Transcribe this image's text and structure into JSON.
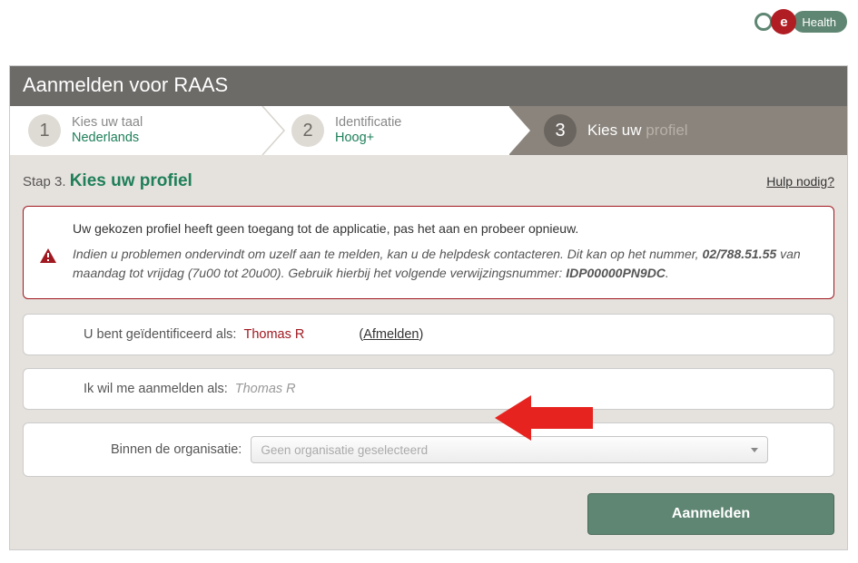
{
  "logo": {
    "e": "e",
    "health": "Health"
  },
  "titlebar": "Aanmelden voor RAAS",
  "stepper": {
    "s1": {
      "num": "1",
      "line1": "Kies uw taal",
      "line2": "Nederlands"
    },
    "s2": {
      "num": "2",
      "line1": "Identificatie",
      "line2": "Hoog+"
    },
    "s3": {
      "num": "3",
      "line1a": "Kies uw ",
      "line1b": "profiel"
    }
  },
  "heading": {
    "prefix": "Stap 3. ",
    "title": "Kies uw profiel",
    "help": "Hulp nodig?"
  },
  "alert": {
    "main": "Uw gekozen profiel heeft geen toegang tot de applicatie, pas het aan en probeer opnieuw.",
    "sub1": "Indien u problemen ondervindt om uzelf aan te melden, kan u de helpdesk contacteren. Dit kan op het nummer, ",
    "phone": "02/788.51.55",
    "sub2a": " van maandag tot vrijdag (7u00 tot 20u00). Gebruik hierbij het volgende verwijzingsnummer: ",
    "ref": "IDP00000PN9DC",
    "sub2b": "."
  },
  "ident": {
    "label": "U bent geïdentificeerd als:",
    "name": "Thomas R",
    "logout_open": "(",
    "logout": "Afmelden",
    "logout_close": ")"
  },
  "loginas": {
    "label": "Ik wil me aanmelden als:",
    "value": "Thomas R"
  },
  "org": {
    "label": "Binnen de organisatie:",
    "placeholder": "Geen organisatie geselecteerd"
  },
  "submit": "Aanmelden"
}
